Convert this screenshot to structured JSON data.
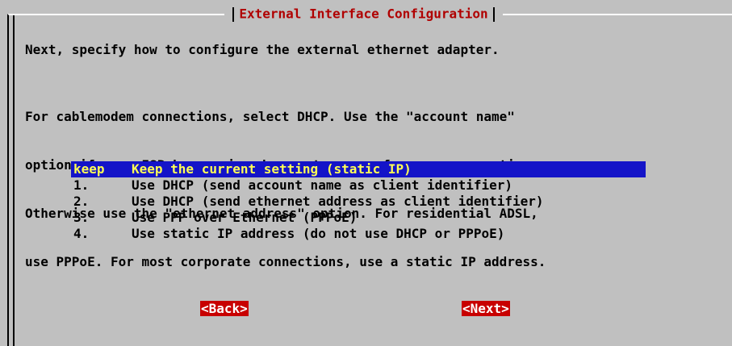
{
  "dialog": {
    "title": "External Interface Configuration"
  },
  "intro_text": "Next, specify how to configure the external ethernet adapter.",
  "description_lines": [
    "For cablemodem connections, select DHCP. Use the \"account name\"",
    "option if your ISP has assigned a system name for your connection.",
    "Otherwise use the \"ethernet address\" option. For residential ADSL,",
    "use PPPoE. For most corporate connections, use a static IP address."
  ],
  "menu": {
    "items": [
      {
        "key": "keep",
        "label": "Keep the current setting (static IP)",
        "selected": true
      },
      {
        "key": "1.",
        "label": "Use DHCP (send account name as client identifier)",
        "selected": false
      },
      {
        "key": "2.",
        "label": "Use DHCP (send ethernet address as client identifier)",
        "selected": false
      },
      {
        "key": "3.",
        "label": "Use PPP over Ethernet (PPPoE)",
        "selected": false
      },
      {
        "key": "4.",
        "label": "Use static IP address (do not use DHCP or PPPoE)",
        "selected": false
      }
    ]
  },
  "buttons": {
    "back": "<Back>",
    "next": "<Next>"
  },
  "colors": {
    "background": "#c0c0c0",
    "title": "#b00000",
    "selection_bg": "#1414c8",
    "selection_fg": "#ffff55",
    "button_bg": "#c80000",
    "button_fg": "#ffffff"
  }
}
